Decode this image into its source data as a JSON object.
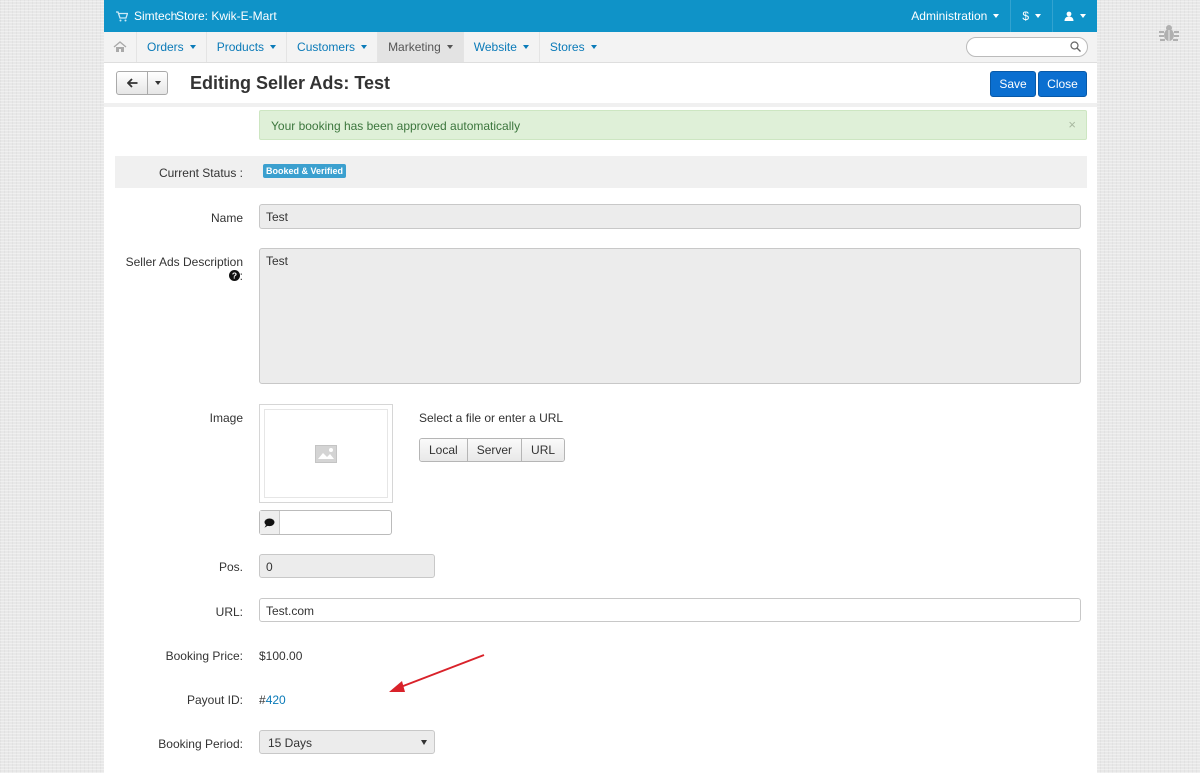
{
  "topbar": {
    "brand": "Simtech",
    "store": "Store: Kwik-E-Mart",
    "admin_label": "Administration",
    "currency_label": "$"
  },
  "nav": {
    "items": [
      {
        "label": "Orders"
      },
      {
        "label": "Products"
      },
      {
        "label": "Customers"
      },
      {
        "label": "Marketing"
      },
      {
        "label": "Website"
      },
      {
        "label": "Stores"
      }
    ],
    "search_placeholder": ""
  },
  "titlebar": {
    "title": "Editing Seller Ads: Test",
    "save_label": "Save",
    "close_label": "Close"
  },
  "alert": {
    "message": "Your booking has been approved automatically",
    "close": "×"
  },
  "form": {
    "current_status_label": "Current Status :",
    "current_status_badge": "Booked & Verified",
    "name_label": "Name",
    "name_value": "Test",
    "description_label": "Seller Ads Description",
    "description_suffix": ":",
    "description_value": "Test",
    "image_label": "Image",
    "image_hint": "Select a file or enter a URL",
    "image_buttons": [
      "Local",
      "Server",
      "URL"
    ],
    "alt_text_value": "",
    "pos_label": "Pos.",
    "pos_value": "0",
    "url_label": "URL:",
    "url_value": "Test.com",
    "booking_price_label": "Booking Price:",
    "booking_price_value": "$100.00",
    "payout_id_label": "Payout ID:",
    "payout_id_prefix": "#",
    "payout_id_link": "420",
    "booking_period_label": "Booking Period:",
    "booking_period_value": "15 Days"
  },
  "colors": {
    "topbar": "#0f93c8",
    "primary_button": "#0b6fd0",
    "badge": "#3ba0cf",
    "alert_bg": "#dff0d8",
    "link": "#0a7ab8",
    "annotation_arrow": "#d9222a"
  },
  "icons": {
    "cart": "cart-icon",
    "home": "home-icon",
    "search": "search-icon",
    "back": "arrow-left-icon",
    "help": "question-circle-icon",
    "image_placeholder": "image-icon",
    "comment": "comment-icon",
    "user": "user-icon",
    "bug": "bug-icon"
  }
}
